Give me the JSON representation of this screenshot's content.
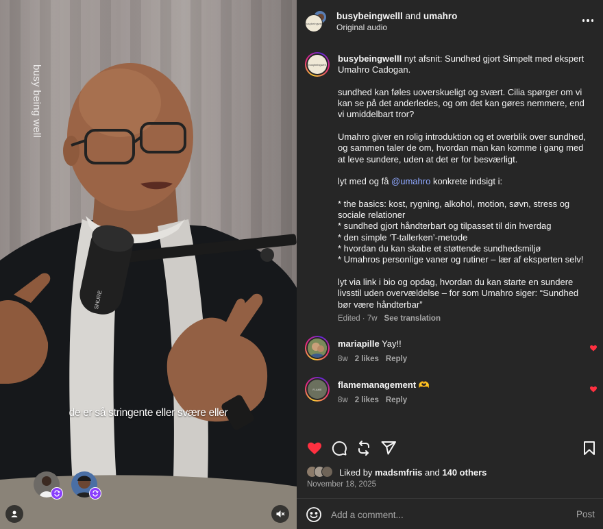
{
  "video": {
    "watermark": "busy being well",
    "caption": "de er så stringente eller svære eller",
    "mic_brand": "SHURE",
    "collab_avatars": [
      {
        "name": "collaborator-1",
        "icon": "remix-icon"
      },
      {
        "name": "collaborator-2",
        "icon": "remix-icon"
      }
    ],
    "profile_icon": "user-icon",
    "mute_icon": "muted-speaker-icon"
  },
  "header": {
    "user1": "busybeingwelll",
    "joiner": "and",
    "user2": "umahro",
    "audio_label": "Original audio",
    "avatar_text": "busybeingwell",
    "more_icon": "more-icon"
  },
  "caption_post": {
    "username": "busybeingwelll",
    "avatar_text": "busybeingwell",
    "intro": "nyt afsnit: Sundhed gjort Simpelt med ekspert Umahro Cadogan.",
    "para1": "sundhed kan føles uoverskueligt og svært. Cilia spørger om vi kan se på det anderledes, og om det kan gøres nemmere, end vi umiddelbart tror?",
    "para2": "Umahro giver en rolig introduktion og et overblik over sundhed, og sammen taler de om, hvordan man kan komme i gang med at leve sundere, uden at det er for besværligt.",
    "para3_before": "lyt med og få ",
    "para3_mention": "@umahro",
    "para3_after": " konkrete indsigt i:",
    "bullets": [
      "* the basics: kost, rygning, alkohol, motion, søvn, stress og sociale relationer",
      "* sundhed gjort håndterbart og tilpasset til din hverdag",
      "* den simple ‘T-tallerken’-metode",
      "* hvordan du kan skabe et støttende sundhedsmiljø",
      "* Umahros personlige vaner og rutiner – lær af eksperten selv!"
    ],
    "para4": "lyt via link i bio og opdag, hvordan du kan starte en sundere livsstil uden overvældelse – for som Umahro siger: “Sundhed bør være håndterbar”",
    "edited": "Edited · 7w",
    "see_translation": "See translation"
  },
  "comments": [
    {
      "username": "mariapille",
      "text": "Yay!!",
      "time": "8w",
      "likes": "2 likes",
      "reply": "Reply",
      "avatar_color": "#7a8a5a",
      "liked": true
    },
    {
      "username": "flamemanagement",
      "text": "🫶",
      "time": "8w",
      "likes": "2 likes",
      "reply": "Reply",
      "avatar_color": "#6b705e",
      "avatar_text": "FLAME",
      "liked": true
    }
  ],
  "actions": {
    "like_icon": "heart-filled-icon",
    "comment_icon": "comment-icon",
    "repost_icon": "repost-icon",
    "share_icon": "share-icon",
    "save_icon": "bookmark-icon",
    "like_color": "#ff3040"
  },
  "likes": {
    "prefix": "Liked by",
    "user": "madsmfriis",
    "joiner": "and",
    "others": "140 others"
  },
  "date": "November 18, 2025",
  "add_comment": {
    "placeholder": "Add a comment...",
    "post_label": "Post",
    "emoji_icon": "emoji-icon"
  },
  "colors": {
    "panel_bg": "#262626",
    "text": "#f5f5f5",
    "muted": "#a8a8a8",
    "mention": "#8fa8ff",
    "accent_heart": "#ff3040"
  }
}
